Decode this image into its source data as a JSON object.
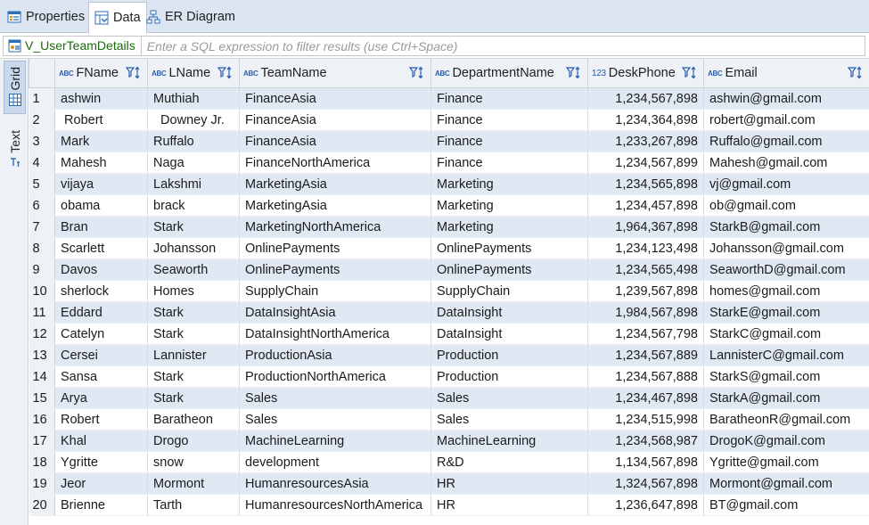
{
  "tabs": [
    {
      "label": "Properties",
      "icon": "properties-icon",
      "active": false
    },
    {
      "label": "Data",
      "icon": "data-icon",
      "active": true
    },
    {
      "label": "ER Diagram",
      "icon": "er-diagram-icon",
      "active": false
    }
  ],
  "filter": {
    "entity": "V_UserTeamDetails",
    "placeholder": "Enter a SQL expression to filter results (use Ctrl+Space)"
  },
  "side_panel": {
    "grid_label": "Grid",
    "text_label": "Text"
  },
  "columns": [
    {
      "name": "FName",
      "type": "ABC"
    },
    {
      "name": "LName",
      "type": "ABC"
    },
    {
      "name": "TeamName",
      "type": "ABC"
    },
    {
      "name": "DepartmentName",
      "type": "ABC"
    },
    {
      "name": "DeskPhone",
      "type": "123"
    },
    {
      "name": "Email",
      "type": "ABC"
    }
  ],
  "rows": [
    [
      "1",
      "ashwin",
      "Muthiah",
      "FinanceAsia",
      "Finance",
      "1,234,567,898",
      "ashwin@gmail.com"
    ],
    [
      "2",
      " Robert",
      "  Downey Jr.",
      "FinanceAsia",
      "Finance",
      "1,234,364,898",
      "robert@gmail.com"
    ],
    [
      "3",
      "Mark",
      "Ruffalo",
      "FinanceAsia",
      "Finance",
      "1,233,267,898",
      "Ruffalo@gmail.com"
    ],
    [
      "4",
      "Mahesh",
      "Naga",
      "FinanceNorthAmerica",
      "Finance",
      "1,234,567,899",
      "Mahesh@gmail.com"
    ],
    [
      "5",
      "vijaya",
      "Lakshmi",
      "MarketingAsia",
      "Marketing",
      "1,234,565,898",
      "vj@gmail.com"
    ],
    [
      "6",
      "obama",
      "brack",
      "MarketingAsia",
      "Marketing",
      "1,234,457,898",
      "ob@gmail.com"
    ],
    [
      "7",
      "Bran",
      "Stark",
      "MarketingNorthAmerica",
      "Marketing",
      "1,964,367,898",
      "StarkB@gmail.com"
    ],
    [
      "8",
      "Scarlett",
      "Johansson",
      "OnlinePayments",
      "OnlinePayments",
      "1,234,123,498",
      "Johansson@gmail.com"
    ],
    [
      "9",
      "Davos",
      "Seaworth",
      "OnlinePayments",
      "OnlinePayments",
      "1,234,565,498",
      "SeaworthD@gmail.com"
    ],
    [
      "10",
      "sherlock",
      "Homes",
      "SupplyChain",
      "SupplyChain",
      "1,239,567,898",
      "homes@gmail.com"
    ],
    [
      "11",
      "Eddard",
      "Stark",
      "DataInsightAsia",
      "DataInsight",
      "1,984,567,898",
      "StarkE@gmail.com"
    ],
    [
      "12",
      "Catelyn",
      "Stark",
      "DataInsightNorthAmerica",
      "DataInsight",
      "1,234,567,798",
      "StarkC@gmail.com"
    ],
    [
      "13",
      "Cersei",
      "Lannister",
      "ProductionAsia",
      "Production",
      "1,234,567,889",
      "LannisterC@gmail.com"
    ],
    [
      "14",
      "Sansa",
      "Stark",
      "ProductionNorthAmerica",
      "Production",
      "1,234,567,888",
      "StarkS@gmail.com"
    ],
    [
      "15",
      "Arya",
      "Stark",
      "Sales",
      "Sales",
      "1,234,467,898",
      "StarkA@gmail.com"
    ],
    [
      "16",
      "Robert",
      "Baratheon",
      "Sales",
      "Sales",
      "1,234,515,998",
      "BaratheonR@gmail.com"
    ],
    [
      "17",
      "Khal",
      "Drogo",
      "MachineLearning",
      "MachineLearning",
      "1,234,568,987",
      "DrogoK@gmail.com"
    ],
    [
      "18",
      "Ygritte",
      "snow",
      "development",
      "R&D",
      "1,134,567,898",
      "Ygritte@gmail.com"
    ],
    [
      "19",
      "Jeor",
      "Mormont",
      "HumanresourcesAsia",
      "HR",
      "1,324,567,898",
      "Mormont@gmail.com"
    ],
    [
      "20",
      "Brienne",
      "Tarth",
      "HumanresourcesNorthAmerica",
      "HR",
      "1,236,647,898",
      "BT@gmail.com"
    ]
  ],
  "colors": {
    "accent": "#2a5db0",
    "row_stripe": "#dfe8f3",
    "entity_text": "#1d6a0e",
    "tabbar": "#dbe5f1"
  }
}
